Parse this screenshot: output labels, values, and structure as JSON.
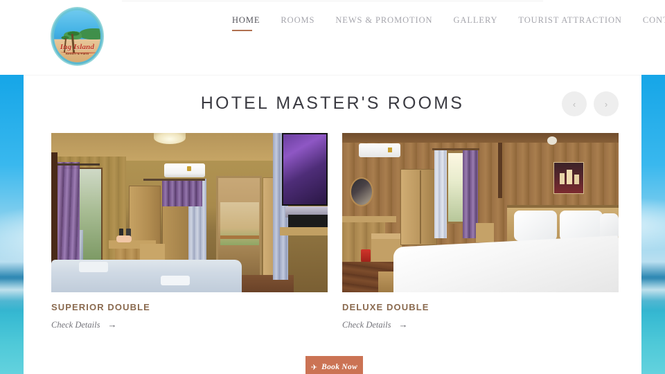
{
  "site": {
    "logo": {
      "name": "Ing Island",
      "tagline": "Resort & Farm",
      "icon": "island-logo-icon"
    }
  },
  "nav": {
    "items": [
      {
        "label": "HOME",
        "active": true
      },
      {
        "label": "ROOMS",
        "active": false
      },
      {
        "label": "NEWS & PROMOTION",
        "active": false
      },
      {
        "label": "GALLERY",
        "active": false
      },
      {
        "label": "TOURIST ATTRACTION",
        "active": false
      },
      {
        "label": "CONTACT US",
        "active": false
      }
    ]
  },
  "section": {
    "title": "HOTEL MASTER'S ROOMS",
    "carousel": {
      "prev_label": "‹",
      "prev_icon": "chevron-left-icon",
      "next_label": "›",
      "next_icon": "chevron-right-icon"
    }
  },
  "rooms": [
    {
      "name": "SUPERIOR DOUBLE",
      "link_label": "Check Details",
      "link_arrow": "→",
      "photo_alt": "wooden-room-with-twin-bed-air-conditioner-and-tv"
    },
    {
      "name": "DELUXE DOUBLE",
      "link_label": "Check Details",
      "link_arrow": "→",
      "photo_alt": "wooden-room-with-king-bed-mirror-and-wardrobe"
    }
  ],
  "book_now": {
    "label": "Book Now",
    "icon": "airplane-icon",
    "icon_glyph": "✈"
  },
  "colors": {
    "accent": "#cb7354",
    "room_title": "#8a6a4f",
    "nav_active": "#55555c",
    "nav_inactive": "#a6a6ad",
    "nav_underline": "#b0704f",
    "sky": "#0d9fe3",
    "sea": "#4fc9d8",
    "carousel_button": "#eeeeee"
  }
}
